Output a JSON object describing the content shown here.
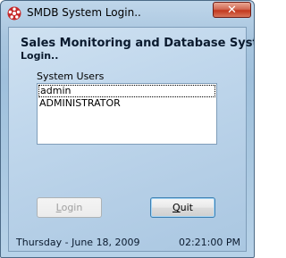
{
  "window": {
    "title": "SMDB System Login..",
    "close_glyph": "✕"
  },
  "header": {
    "title": "Sales Monitoring and Database System",
    "subtitle": "Login.."
  },
  "users": {
    "label": "System Users",
    "items": [
      {
        "label": "admin",
        "focused": true
      },
      {
        "label": "ADMINISTRATOR",
        "focused": false
      }
    ]
  },
  "buttons": {
    "login": {
      "first": "L",
      "rest": "ogin",
      "enabled": false
    },
    "quit": {
      "first": "Q",
      "rest": "uit",
      "enabled": true
    }
  },
  "status": {
    "date": "Thursday - June 18, 2009",
    "time": "02:21:00 PM"
  },
  "icons": {
    "app": "reel-icon",
    "close": "close-icon"
  },
  "colors": {
    "close_button": "#c2381d",
    "panel": "#b4cee6"
  }
}
